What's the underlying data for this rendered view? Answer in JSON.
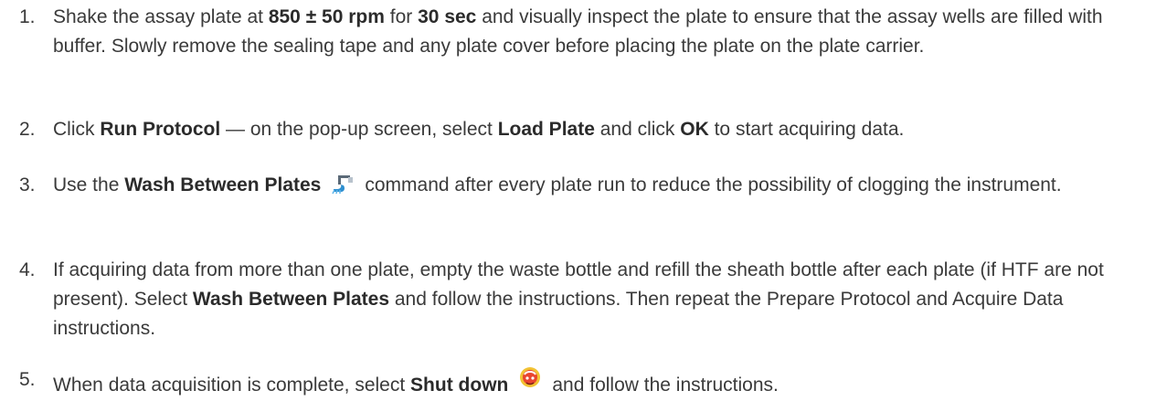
{
  "steps": [
    {
      "number": "1.",
      "parts": {
        "p1": "Shake the assay plate at ",
        "b1": "850 ± 50 rpm",
        "p2": " for ",
        "b2": "30 sec",
        "p3": " and visually inspect the plate to ensure that the assay wells are filled with buffer. Slowly remove the sealing tape and any plate cover before placing the plate on the plate carrier."
      }
    },
    {
      "number": "2.",
      "parts": {
        "p1": "Click ",
        "b1": "Run Protocol",
        "p2": " — on the pop-up screen, select ",
        "b2": "Load Plate",
        "p3": " and click ",
        "b3": "OK",
        "p4": " to start acquiring data."
      }
    },
    {
      "number": "3.",
      "icon": "wash-between-plates-icon",
      "parts": {
        "p1": "Use the ",
        "b1": "Wash Between Plates",
        "p2": "command after every plate run to reduce the possibility of clogging the instrument."
      }
    },
    {
      "number": "4.",
      "parts": {
        "p1": "If acquiring data from more than one plate, empty the waste bottle and refill the sheath bottle after each plate (if HTF are not present). Select ",
        "b1": "Wash Between Plates",
        "p2": " and follow the instructions. Then repeat the Prepare Protocol and Acquire Data instructions."
      }
    },
    {
      "number": "5.",
      "icon": "shut-down-icon",
      "parts": {
        "p1": "When data acquisition is complete, select ",
        "b1": "Shut down",
        "p2": "and follow the instructions."
      }
    }
  ]
}
